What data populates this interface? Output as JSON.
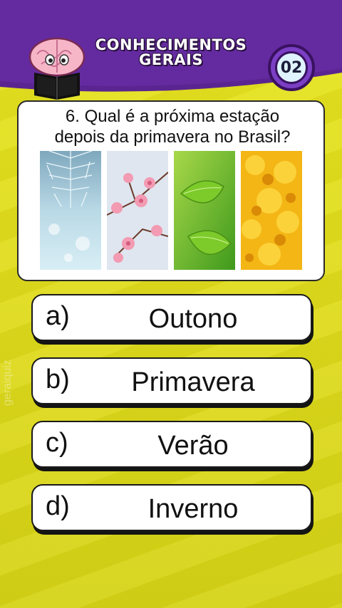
{
  "header": {
    "title_line1": "CONHECIMENTOS",
    "title_line2": "GERAIS",
    "counter": "02",
    "colors": {
      "header_bg": "#5a2590",
      "header_dark": "#3a1160",
      "accent": "#7a3fc4"
    }
  },
  "question": {
    "text_line1": "6. Qual é a próxima estação",
    "text_line2": "depois da primavera no Brasil?",
    "images": [
      "winter-frost-icon",
      "spring-blossom-icon",
      "summer-leaves-icon",
      "autumn-leaves-icon"
    ]
  },
  "answers": [
    {
      "letter": "a)",
      "text": "Outono"
    },
    {
      "letter": "b)",
      "text": "Primavera"
    },
    {
      "letter": "c)",
      "text": "Verão"
    },
    {
      "letter": "d)",
      "text": "Inverno"
    }
  ],
  "watermark": "geraiquiz",
  "colors": {
    "background": "#e2df1a"
  }
}
